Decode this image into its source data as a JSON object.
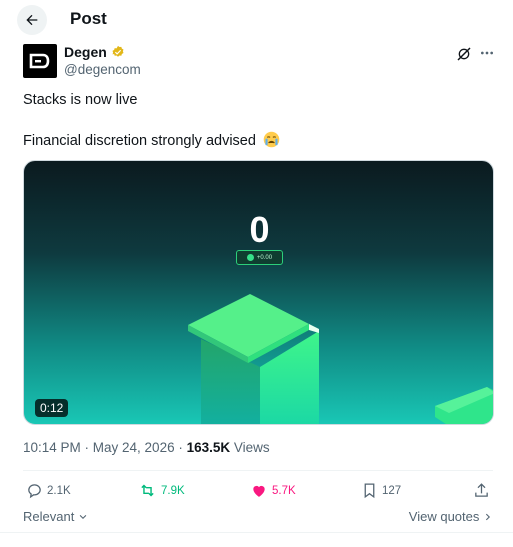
{
  "header": {
    "title": "Post"
  },
  "author": {
    "name": "Degen",
    "handle": "@degencom"
  },
  "post": {
    "line1": "Stacks is now live",
    "line2": "Financial discretion strongly advised",
    "line2_emoji": "tearful-face-emoji"
  },
  "media": {
    "score": "0",
    "pill_text": "+0.00",
    "duration": "0:12"
  },
  "meta": {
    "time_date": "10:14 PM · May 24, 2026 · ",
    "views_count": "163.5K",
    "views_label": " Views"
  },
  "actions": {
    "replies": "2.1K",
    "reposts": "7.9K",
    "likes": "5.7K",
    "bookmarks": "127"
  },
  "footer": {
    "sort_label": "Relevant",
    "view_quotes": "View quotes"
  },
  "colors": {
    "repost": "#00ba7c",
    "like": "#f91880",
    "muted": "#536471"
  }
}
